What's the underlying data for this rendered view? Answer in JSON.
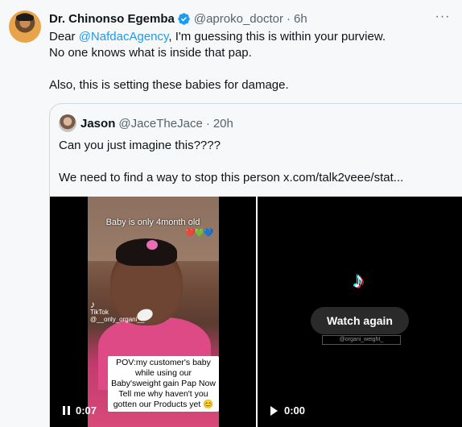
{
  "tweet": {
    "name": "Dr. Chinonso Egemba",
    "handle": "@aproko_doctor",
    "separator": "·",
    "time": "6h",
    "more": "···",
    "line1_pre": "Dear ",
    "mention": "@NafdacAgency",
    "line1_post": ", I'm guessing this is within your purview.",
    "line2": "No one knows what is inside that pap.",
    "line3": "Also, this is setting these babies for damage."
  },
  "quote": {
    "name": "Jason",
    "handle": "@JaceTheJace",
    "separator": "·",
    "time": "20h",
    "line1": "Can you just imagine this????",
    "line2": "We need to find a way to stop this person  x.com/talk2veee/stat..."
  },
  "video_left": {
    "top_caption": "Baby is only 4month old",
    "hearts": [
      "❤️",
      "💚",
      "💙"
    ],
    "tiktok_label": "TikTok",
    "tiktok_user": "@__only_organi__",
    "caption": "POV:my customer's baby while using our Baby'sweight gain Pap Now Tell me why haven't you gotten our Products yet 😊",
    "time": "0:07"
  },
  "video_right": {
    "watch_again": "Watch again",
    "tiktok_user": "@organi_weight_",
    "time": "0:00"
  },
  "colors": {
    "accent": "#1d9bf0",
    "muted": "#536471",
    "text": "#0f1419"
  }
}
